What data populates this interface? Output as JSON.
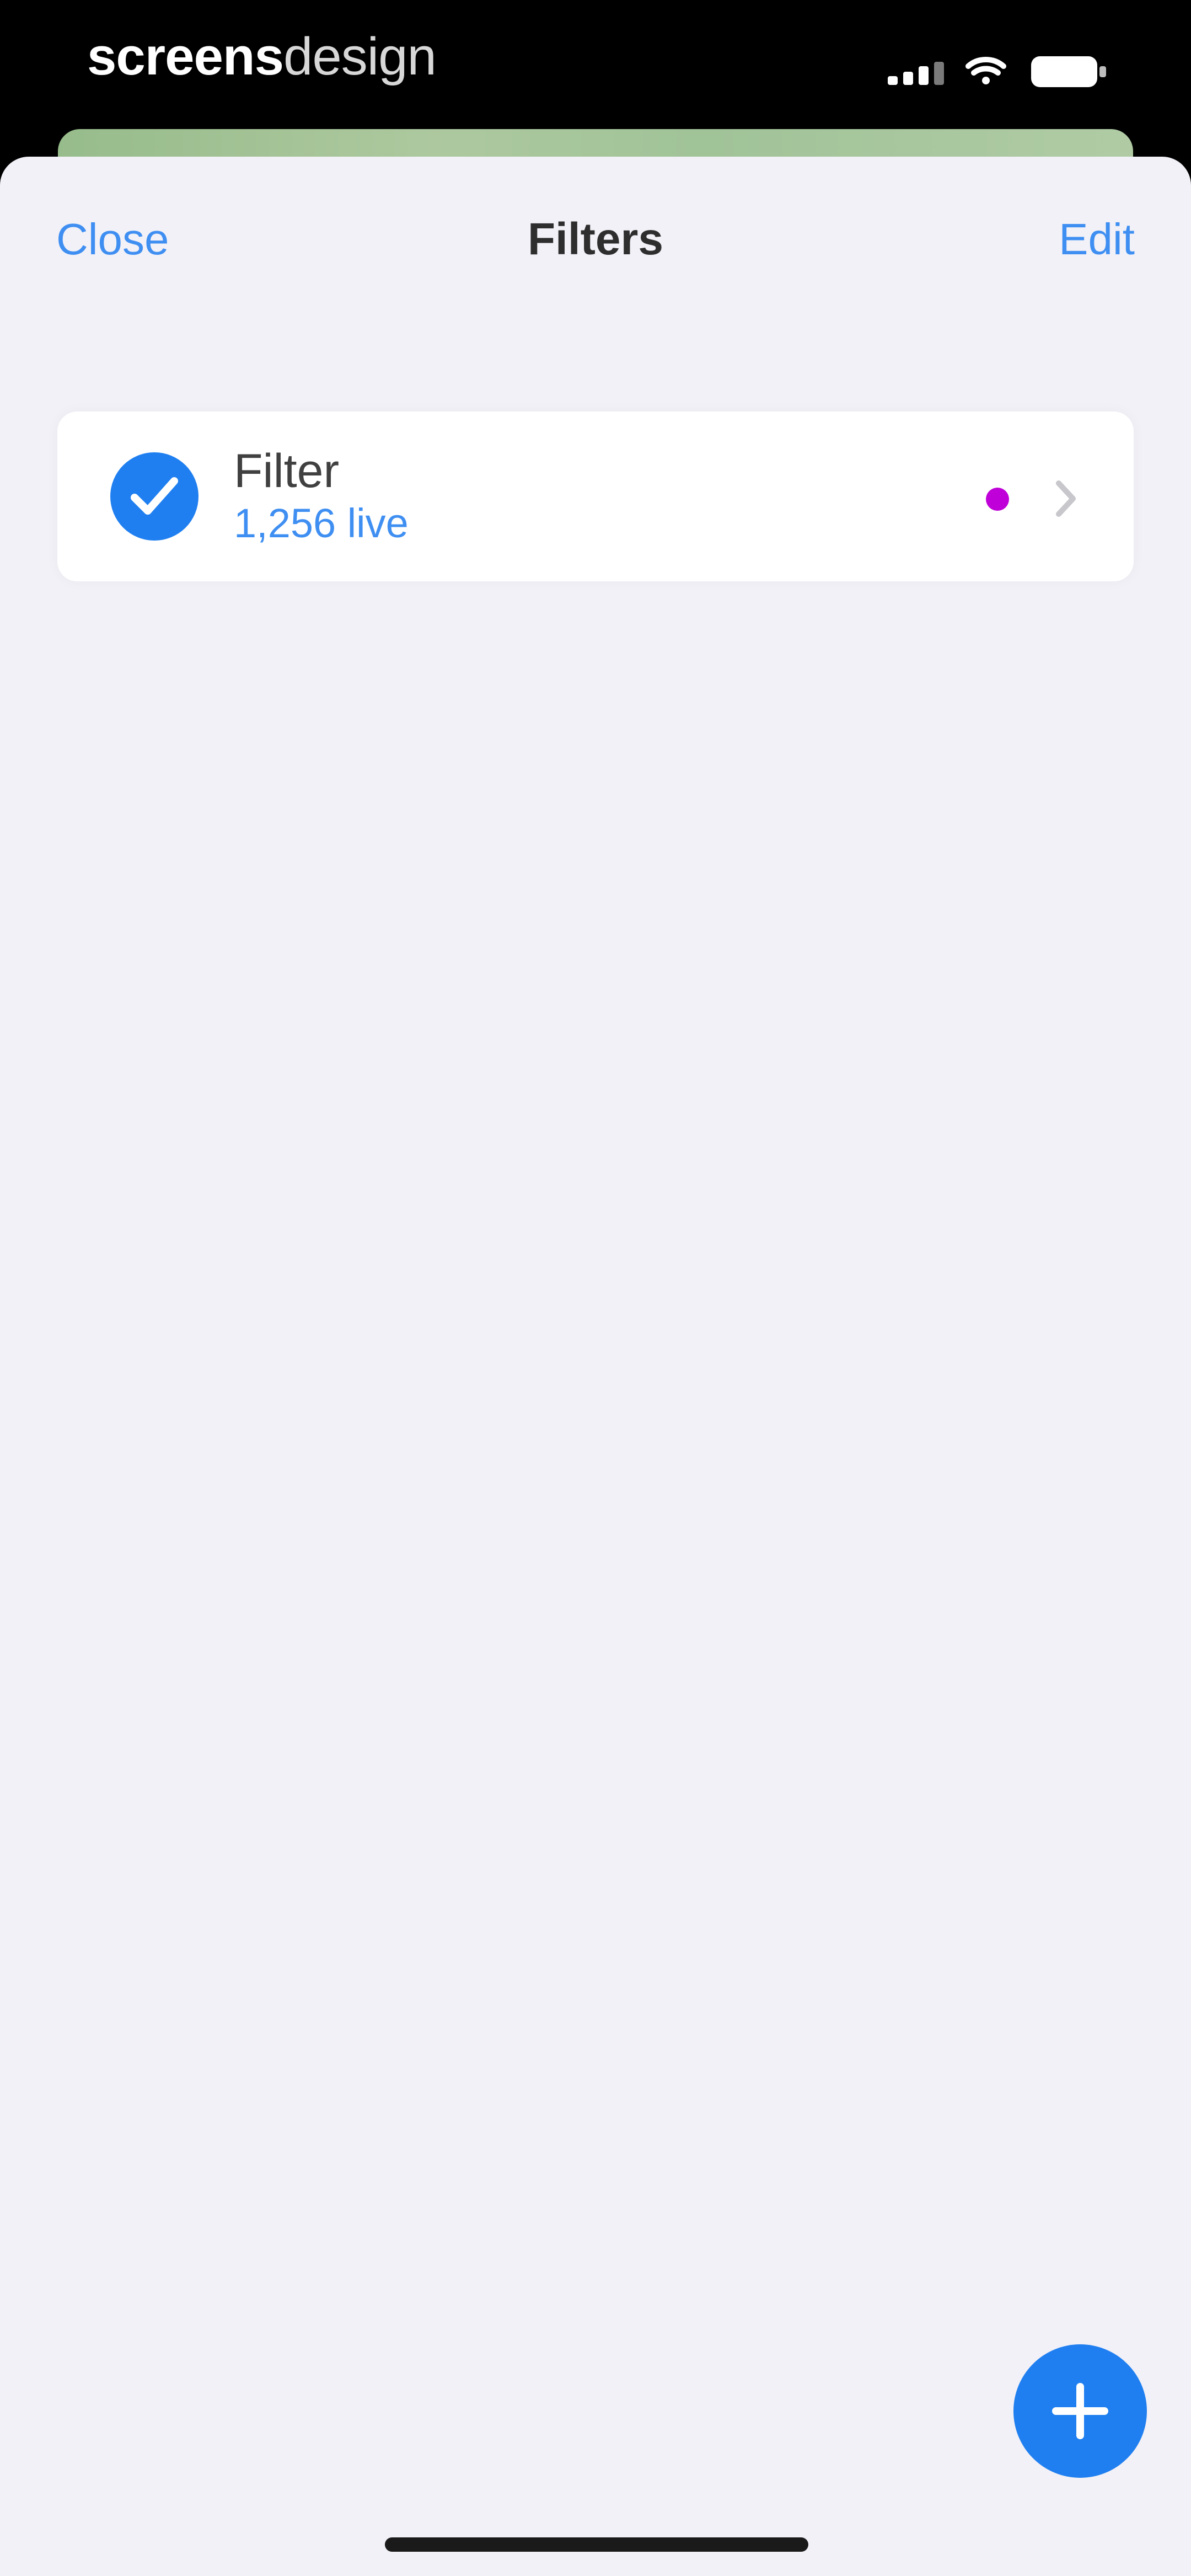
{
  "status_bar": {
    "brand_bold": "screens",
    "brand_light": "design"
  },
  "nav": {
    "left_label": "Close",
    "title": "Filters",
    "right_label": "Edit"
  },
  "filters": {
    "items": [
      {
        "name": "Filter",
        "count": "1,256 live",
        "selected": true,
        "dot_color": "#c000d8"
      }
    ]
  },
  "icons": {
    "status": [
      "signal-icon",
      "wifi-icon",
      "battery-icon"
    ],
    "row": [
      "checkmark-icon",
      "chevron-right-icon"
    ],
    "fab": "plus-icon"
  },
  "colors": {
    "accent": "#1f7ff0",
    "link": "#3f8ff2",
    "sheet_bg": "#f2f1f7",
    "status_bg": "#000000"
  }
}
